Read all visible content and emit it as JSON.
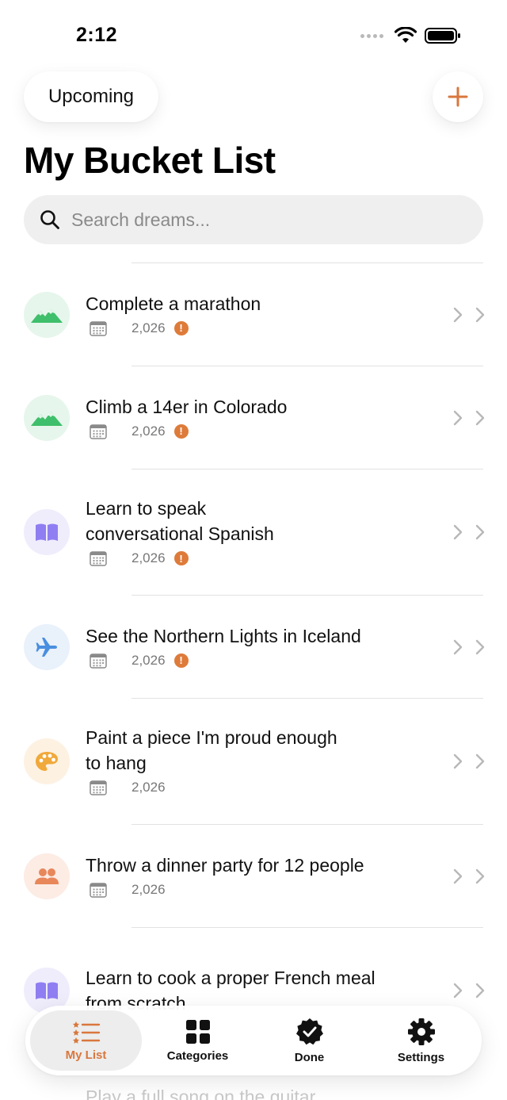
{
  "status": {
    "time": "2:12"
  },
  "header": {
    "upcoming_label": "Upcoming",
    "title": "My Bucket List"
  },
  "search": {
    "placeholder": "Search dreams..."
  },
  "items": [
    {
      "title_lines": [
        "Complete a marathon"
      ],
      "year": "2,026",
      "warning": true,
      "icon": "mountain-icon",
      "icon_color": "#3fbf6b",
      "bg": "#e6f6ec"
    },
    {
      "title_lines": [
        "Climb a 14er in Colorado"
      ],
      "year": "2,026",
      "warning": true,
      "icon": "mountain-icon",
      "icon_color": "#3fbf6b",
      "bg": "#e6f6ec"
    },
    {
      "title_lines": [
        "Learn to speak",
        "conversational Spanish"
      ],
      "year": "2,026",
      "warning": true,
      "icon": "book-icon",
      "icon_color": "#8f7ef2",
      "bg": "#efedfc"
    },
    {
      "title_lines": [
        "See the Northern Lights in Iceland"
      ],
      "year": "2,026",
      "warning": true,
      "icon": "airplane-icon",
      "icon_color": "#4a8fe0",
      "bg": "#e9f1fb"
    },
    {
      "title_lines": [
        "Paint a piece I'm proud enough",
        "to hang"
      ],
      "year": "2,026",
      "warning": false,
      "icon": "palette-icon",
      "icon_color": "#f0a93a",
      "bg": "#fdf1e2"
    },
    {
      "title_lines": [
        "Throw a dinner party for 12 people"
      ],
      "year": "2,026",
      "warning": false,
      "icon": "people-icon",
      "icon_color": "#e8875a",
      "bg": "#fcece4"
    },
    {
      "title_lines": [
        "Learn to cook a proper French meal",
        "from scratch"
      ],
      "year": "",
      "warning": false,
      "icon": "book-icon",
      "icon_color": "#8f7ef2",
      "bg": "#efedfc"
    }
  ],
  "peek_item": "Play a full song on the guitar",
  "tabs": [
    {
      "label": "My List",
      "icon": "list-icon",
      "active": true
    },
    {
      "label": "Categories",
      "icon": "grid-icon",
      "active": false
    },
    {
      "label": "Done",
      "icon": "checkmark-seal-icon",
      "active": false
    },
    {
      "label": "Settings",
      "icon": "gear-icon",
      "active": false
    }
  ],
  "colors": {
    "accent": "#d9773d",
    "warning": "#de7b3a"
  }
}
